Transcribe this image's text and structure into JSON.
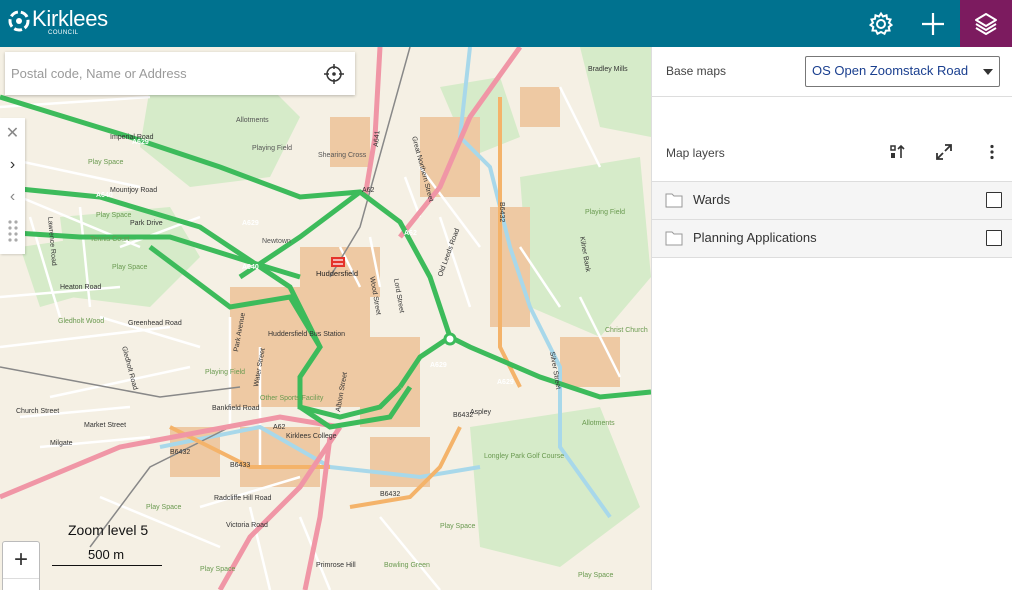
{
  "header": {
    "logo_text": "Kirklees",
    "logo_sub": "COUNCIL",
    "brand_color": "#00728f",
    "active_color": "#7c1b5f",
    "buttons": [
      "gear-icon",
      "plus-icon",
      "layers-icon"
    ]
  },
  "search": {
    "placeholder": "Postal code, Name or Address"
  },
  "map": {
    "zoom_label": "Zoom level 5",
    "scale_label": "500 m",
    "place_labels": [
      "Allotments",
      "Playing Field",
      "Shearing Cross",
      "Newtown",
      "Huddersfield",
      "Huddersfield Bus Station",
      "Kirklees College",
      "Aspley",
      "Other Sports Facility",
      "Longley Park Golf Course",
      "Play Space",
      "Tennis Court",
      "Gledholt Wood",
      "Bradley Mills",
      "Primrose Hill",
      "Bowling Green",
      "Christ Church",
      "Allotments"
    ],
    "road_labels": [
      "A629",
      "A640",
      "A62",
      "A641",
      "A616",
      "B6432",
      "B6433",
      "Wood Street",
      "Lord Street",
      "Old Leeds Road",
      "Great Northern Street",
      "Mountjoy Road",
      "Park Drive",
      "Lawrence Road",
      "Heaton Road",
      "Greenhead Road",
      "Gledholt Road",
      "Park Avenue",
      "Water Street",
      "Albion Street",
      "Bankfield Road",
      "Market Street",
      "High Street",
      "Church Street",
      "Milgate",
      "Radcliffe Hill Road",
      "Victoria Road",
      "Kilner Bank",
      "Silver Street",
      "Imperial Road",
      "Allen Row",
      "Mark Street"
    ]
  },
  "panel": {
    "base_maps_label": "Base maps",
    "base_map_selected": "OS Open Zoomstack Road",
    "map_layers_label": "Map layers",
    "layers": [
      {
        "label": "Wards",
        "checked": false
      },
      {
        "label": "Planning Applications",
        "checked": false
      }
    ]
  }
}
